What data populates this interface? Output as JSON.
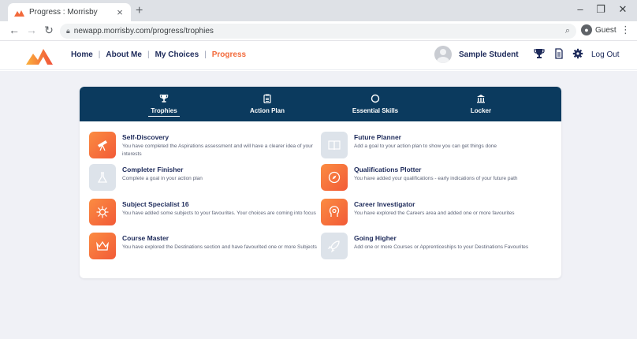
{
  "browser": {
    "tab_title": "Progress : Morrisby",
    "url": "newapp.morrisby.com/progress/trophies",
    "profile_label": "Guest"
  },
  "header": {
    "nav": [
      {
        "label": "Home",
        "active": false
      },
      {
        "label": "About Me",
        "active": false
      },
      {
        "label": "My Choices",
        "active": false
      },
      {
        "label": "Progress",
        "active": true
      }
    ],
    "user_name": "Sample Student",
    "logout_label": "Log Out",
    "icons": [
      "trophy-icon",
      "document-icon",
      "gear-icon"
    ]
  },
  "colors": {
    "brand_navy": "#0b3a5e",
    "accent_orange": "#f26a3b",
    "locked_badge": "#dde3ea"
  },
  "progress_tabs": [
    {
      "label": "Trophies",
      "icon": "trophy-icon",
      "active": true
    },
    {
      "label": "Action Plan",
      "icon": "clipboard-icon",
      "active": false
    },
    {
      "label": "Essential Skills",
      "icon": "circle-icon",
      "active": false
    },
    {
      "label": "Locker",
      "icon": "locker-icon",
      "active": false
    }
  ],
  "trophies": [
    {
      "name": "Self-Discovery",
      "description": "You have completed the Aspirations assessment and will have a clearer idea of your interests",
      "earned": true,
      "icon": "telescope-icon"
    },
    {
      "name": "Future Planner",
      "description": "Add a goal to your action plan to show you can get things done",
      "earned": false,
      "icon": "book-icon"
    },
    {
      "name": "Completer Finisher",
      "description": "Complete a goal in your action plan",
      "earned": false,
      "icon": "flask-icon"
    },
    {
      "name": "Qualifications Plotter",
      "description": "You have added your qualifications - early indications of your future path",
      "earned": true,
      "icon": "compass-icon"
    },
    {
      "name": "Subject Specialist 16",
      "description": "You have added some subjects to your favourites. Your choices are coming into focus",
      "earned": true,
      "icon": "virus-icon"
    },
    {
      "name": "Career Investigator",
      "description": "You have explored the Careers area and added one or more favourites",
      "earned": true,
      "icon": "head-gear-icon"
    },
    {
      "name": "Course Master",
      "description": "You have explored the Destinations section and have favourited one or more Subjects",
      "earned": true,
      "icon": "crown-icon"
    },
    {
      "name": "Going Higher",
      "description": "Add one or more Courses or Apprenticeships to your Destinations Favourites",
      "earned": false,
      "icon": "rocket-icon"
    }
  ]
}
